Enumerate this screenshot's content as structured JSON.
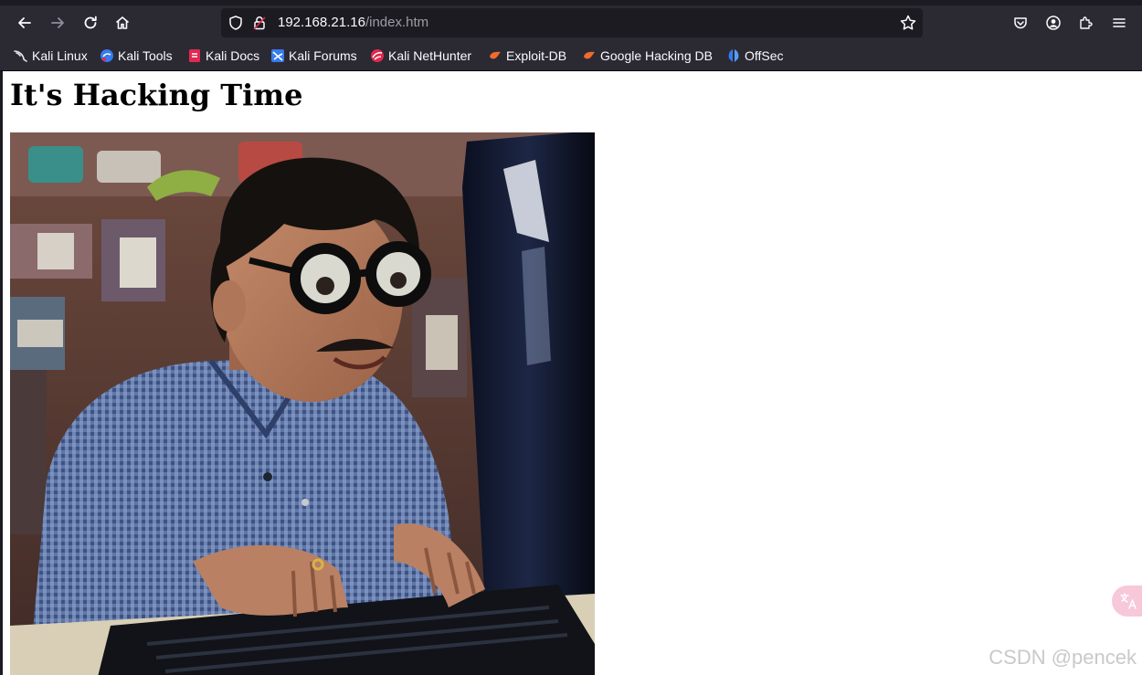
{
  "toolbar": {
    "nav_icons": [
      "back-arrow-icon",
      "forward-arrow-icon",
      "reload-icon",
      "home-icon"
    ],
    "url_host": "192.168.21.16",
    "url_path": "/index.htm",
    "right_icons": [
      "pocket-icon",
      "account-icon",
      "extensions-icon",
      "menu-icon"
    ]
  },
  "bookmarks": [
    {
      "label": "Kali Linux",
      "icon": "kali-dragon-icon"
    },
    {
      "label": "Kali Tools",
      "icon": "kali-tools-icon"
    },
    {
      "label": "Kali Docs",
      "icon": "kali-docs-icon"
    },
    {
      "label": "Kali Forums",
      "icon": "kali-forums-icon"
    },
    {
      "label": "Kali NetHunter",
      "icon": "kali-nethunter-icon"
    },
    {
      "label": "Exploit-DB",
      "icon": "exploit-db-icon"
    },
    {
      "label": "Google Hacking DB",
      "icon": "ghdb-icon"
    },
    {
      "label": "OffSec",
      "icon": "offsec-icon"
    }
  ],
  "page": {
    "title": "It's Hacking Time",
    "image_subject": "man with thick glasses typing on keyboard in front of monitor"
  },
  "watermark": "CSDN @pencek",
  "colors": {
    "chrome_dark": "#1c1b22",
    "toolbar": "#2b2a33",
    "page_bg": "#ffffff"
  }
}
